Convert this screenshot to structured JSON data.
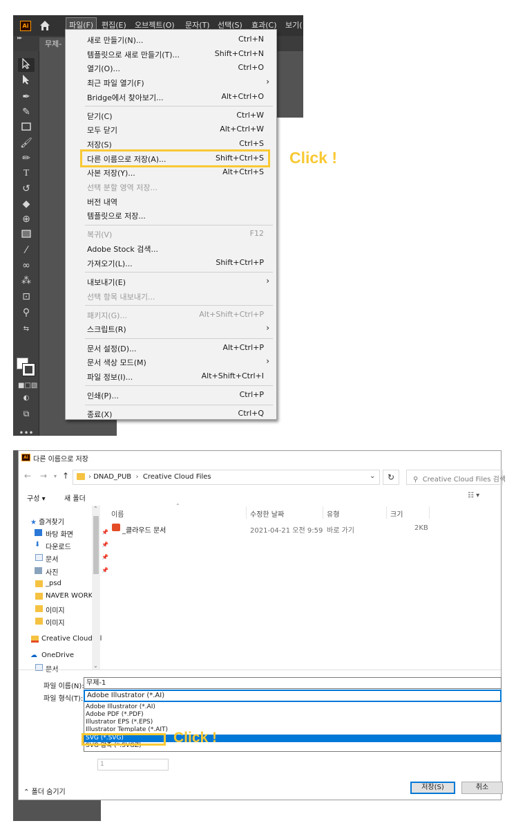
{
  "illustrator": {
    "logo": "Ai",
    "menubar": [
      "파일(F)",
      "편집(E)",
      "오브젝트(O)",
      "문자(T)",
      "선택(S)",
      "효과(C)",
      "보기("
    ],
    "document_tab": "무제-",
    "file_menu": [
      {
        "label": "새로 만들기(N)...",
        "shortcut": "Ctrl+N"
      },
      {
        "label": "템플릿으로 새로 만들기(T)...",
        "shortcut": "Shift+Ctrl+N"
      },
      {
        "label": "열기(O)...",
        "shortcut": "Ctrl+O"
      },
      {
        "label": "최근 파일 열기(F)",
        "shortcut": "",
        "submenu": true
      },
      {
        "label": "Bridge에서 찾아보기...",
        "shortcut": "Alt+Ctrl+O"
      },
      {
        "label": "닫기(C)",
        "shortcut": "Ctrl+W"
      },
      {
        "label": "모두 닫기",
        "shortcut": "Alt+Ctrl+W"
      },
      {
        "label": "저장(S)",
        "shortcut": "Ctrl+S"
      },
      {
        "label": "다른 이름으로 저장(A)...",
        "shortcut": "Shift+Ctrl+S"
      },
      {
        "label": "사본 저장(Y)...",
        "shortcut": "Alt+Ctrl+S"
      },
      {
        "label": "선택 분할 영역 저장...",
        "shortcut": "",
        "disabled": true
      },
      {
        "label": "버전 내역",
        "shortcut": ""
      },
      {
        "label": "템플릿으로 저장...",
        "shortcut": ""
      },
      {
        "label": "복귀(V)",
        "shortcut": "F12",
        "disabled": true
      },
      {
        "label": "Adobe Stock 검색...",
        "shortcut": ""
      },
      {
        "label": "가져오기(L)...",
        "shortcut": "Shift+Ctrl+P"
      },
      {
        "label": "내보내기(E)",
        "shortcut": "",
        "submenu": true
      },
      {
        "label": "선택 항목 내보내기...",
        "shortcut": "",
        "disabled": true
      },
      {
        "label": "패키지(G)...",
        "shortcut": "Alt+Shift+Ctrl+P",
        "disabled": true
      },
      {
        "label": "스크립트(R)",
        "shortcut": "",
        "submenu": true
      },
      {
        "label": "문서 설정(D)...",
        "shortcut": "Alt+Ctrl+P"
      },
      {
        "label": "문서 색상 모드(M)",
        "shortcut": "",
        "submenu": true
      },
      {
        "label": "파일 정보(I)...",
        "shortcut": "Alt+Shift+Ctrl+I"
      },
      {
        "label": "인쇄(P)...",
        "shortcut": "Ctrl+P"
      },
      {
        "label": "종료(X)",
        "shortcut": "Ctrl+Q"
      }
    ],
    "click_annotation": "Click !"
  },
  "save_dialog": {
    "title": "다른 이름으로 저장",
    "breadcrumb": [
      "DNAD_PUB",
      "Creative Cloud Files"
    ],
    "search_placeholder": "Creative Cloud Files 검색",
    "toolbar": {
      "organize": "구성 ▾",
      "new_folder": "새 폴더"
    },
    "nav": {
      "quick_access": "즐겨찾기",
      "items": [
        "바탕 화면",
        "다운로드",
        "문서",
        "사진",
        "_psd",
        "NAVER WORKS",
        "이미지",
        "이미지"
      ],
      "creative_cloud": "Creative Cloud Fil",
      "onedrive": "OneDrive",
      "onedrive_docs": "문서"
    },
    "columns": [
      "이름",
      "수정한 날짜",
      "유형",
      "크기"
    ],
    "files": [
      {
        "name": "_클라우드 문서",
        "modified": "2021-04-21 오전 9:59",
        "type": "바로 가기",
        "size": "2KB"
      }
    ],
    "filename_label": "파일 이름(N):",
    "filename_value": "무제-1",
    "filetype_label": "파일 형식(T):",
    "filetype_value": "Adobe Illustrator (*.AI)",
    "filetype_options": [
      "Adobe Illustrator (*.AI)",
      "Adobe PDF (*.PDF)",
      "Illustrator EPS (*.EPS)",
      "Illustrator Template (*.AIT)",
      "SVG (*.SVG)",
      "SVG 압축 (*.SVGZ)"
    ],
    "selected_option_index": 4,
    "ghost_input": "1",
    "hide_folders": "폴더 숨기기",
    "save_button": "저장(S)",
    "cancel_button": "취소",
    "click_annotation": "Click !"
  },
  "colors": {
    "highlight": "#f9c933",
    "selection": "#0078d7",
    "ai_dark": "#323232"
  }
}
